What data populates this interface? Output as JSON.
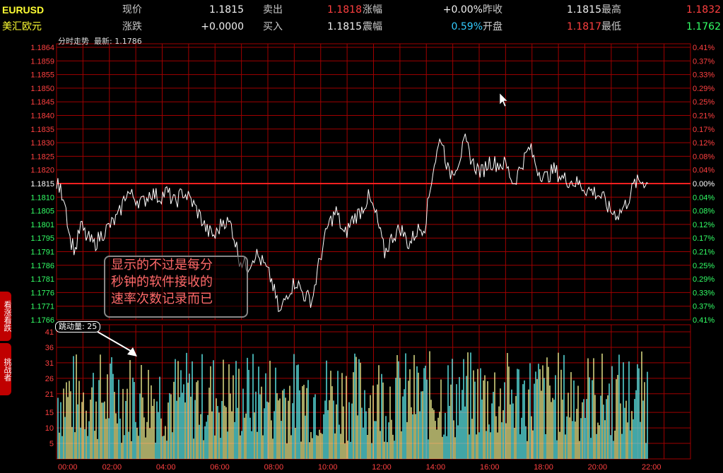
{
  "header": {
    "symbol": "EURUSD",
    "name": "美汇欧元",
    "row1": [
      {
        "label": "现价",
        "value": "1.1815",
        "value_color": "#f0f0f0"
      },
      {
        "label": "卖出",
        "value": "1.1818",
        "value_color": "#ff4040"
      },
      {
        "label": "涨幅",
        "value": "+0.00%",
        "value_color": "#f0f0f0"
      },
      {
        "label": "昨收",
        "value": "1.1815",
        "value_color": "#f0f0f0"
      },
      {
        "label": "最高",
        "value": "1.1832",
        "value_color": "#ff4040"
      }
    ],
    "row2": [
      {
        "label": "涨跌",
        "value": "+0.0000",
        "value_color": "#f0f0f0"
      },
      {
        "label": "买入",
        "value": "1.1815",
        "value_color": "#f0f0f0"
      },
      {
        "label": "震幅",
        "value": "0.59%",
        "value_color": "#33ccff"
      },
      {
        "label": "开盘",
        "value": "1.1817",
        "value_color": "#ff4040"
      },
      {
        "label": "最低",
        "value": "1.1762",
        "value_color": "#33ff66"
      }
    ]
  },
  "chart_title": "分时走势",
  "latest_label": "最新: 1.1786",
  "volume_badge": "跳动量: 25",
  "side_tabs": [
    "看涨看跌",
    "挑战者"
  ],
  "annotation": [
    "显示的不过是每分",
    "秒钟的软件接收的",
    "速率次数记录而已"
  ],
  "colors": {
    "grid": "#a00000",
    "up": "#ff4040",
    "down": "#33ff66",
    "price_line": "#ffffff",
    "prev_close": "#ff2020",
    "vol_a": "#66ffff",
    "vol_b": "#ffff99"
  },
  "chart_data": {
    "type": "line",
    "prev_close": 1.1815,
    "price_axis": [
      "1.1864",
      "1.1859",
      "1.1855",
      "1.1850",
      "1.1845",
      "1.1840",
      "1.1835",
      "1.1830",
      "1.1825",
      "1.1820",
      "1.1815",
      "1.1810",
      "1.1805",
      "1.1801",
      "1.1795",
      "1.1791",
      "1.1786",
      "1.1781",
      "1.1776",
      "1.1771",
      "1.1766"
    ],
    "pct_axis": [
      "0.41%",
      "0.37%",
      "0.33%",
      "0.29%",
      "0.25%",
      "0.21%",
      "0.17%",
      "0.12%",
      "0.08%",
      "0.04%",
      "0.00%",
      "0.04%",
      "0.08%",
      "0.12%",
      "0.17%",
      "0.21%",
      "0.25%",
      "0.29%",
      "0.33%",
      "0.37%",
      "0.41%"
    ],
    "ylim": [
      1.1766,
      1.1864
    ],
    "time_axis": [
      "00:00",
      "02:00",
      "04:00",
      "06:00",
      "08:00",
      "10:00",
      "12:00",
      "14:00",
      "16:00",
      "18:00",
      "20:00",
      "22:00"
    ],
    "x_hours": [
      0,
      0.3,
      0.5,
      0.7,
      0.9,
      1.1,
      1.4,
      1.7,
      2.0,
      2.3,
      2.6,
      2.9,
      3.2,
      3.5,
      3.8,
      4.1,
      4.4,
      4.7,
      5.0,
      5.3,
      5.6,
      5.9,
      6.2,
      6.5,
      6.8,
      7.1,
      7.4,
      7.7,
      8.0,
      8.3,
      8.6,
      8.9,
      9.2,
      9.5,
      9.8,
      10.1,
      10.4,
      10.7,
      11.0,
      11.3,
      11.6,
      11.9,
      12.2,
      12.5,
      12.8,
      13.1,
      13.4,
      13.7,
      14.0,
      14.3,
      14.6,
      14.9,
      15.2,
      15.5,
      15.8,
      16.1,
      16.4,
      16.7,
      17.0,
      17.3,
      17.6,
      17.9,
      18.2,
      18.5,
      18.8,
      19.1,
      19.4,
      19.7,
      20.0,
      20.3,
      20.6,
      20.9,
      21.2,
      21.5,
      21.8,
      22.0
    ],
    "price": [
      1.1815,
      1.181,
      1.1795,
      1.1791,
      1.18,
      1.1796,
      1.1793,
      1.1797,
      1.18,
      1.1803,
      1.1812,
      1.181,
      1.1808,
      1.1812,
      1.181,
      1.1812,
      1.1808,
      1.1812,
      1.1809,
      1.1804,
      1.1798,
      1.1796,
      1.1802,
      1.18,
      1.1788,
      1.1785,
      1.179,
      1.1786,
      1.178,
      1.1768,
      1.1776,
      1.178,
      1.1775,
      1.1773,
      1.1788,
      1.18,
      1.1805,
      1.1796,
      1.1802,
      1.1805,
      1.181,
      1.1803,
      1.179,
      1.1796,
      1.1799,
      1.1793,
      1.1798,
      1.18,
      1.182,
      1.1832,
      1.1818,
      1.1822,
      1.183,
      1.1822,
      1.1819,
      1.1823,
      1.1822,
      1.1822,
      1.1815,
      1.1822,
      1.1828,
      1.182,
      1.1817,
      1.182,
      1.1817,
      1.1816,
      1.1815,
      1.1813,
      1.1812,
      1.181,
      1.1805,
      1.1804,
      1.1808,
      1.1815,
      1.1816,
      1.1815
    ],
    "volume_axis": [
      "41",
      "36",
      "31",
      "26",
      "21",
      "15",
      "10",
      "5"
    ],
    "volume_ylim": [
      0,
      41
    ]
  }
}
